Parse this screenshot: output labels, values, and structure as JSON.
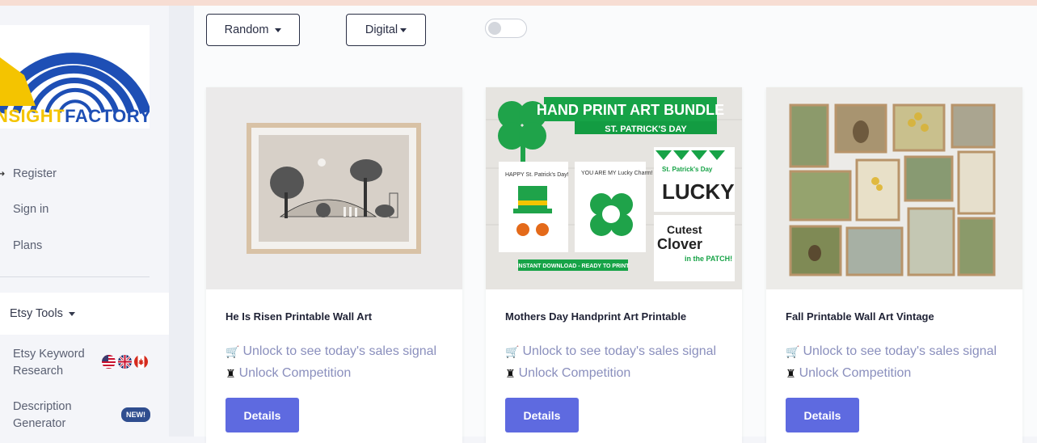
{
  "logo": {
    "part1": "NSIGHT",
    "part2": "FACTORY"
  },
  "nav": {
    "register": "Register",
    "signin": "Sign in",
    "plans": "Plans"
  },
  "tools": {
    "label": "Etsy Tools",
    "keyword_research": "Etsy Keyword Research",
    "description_generator": "Description Generator",
    "new_badge": "NEW!"
  },
  "filters": {
    "sort": "Random",
    "type": "Digital"
  },
  "cards": [
    {
      "title": "He Is Risen Printable Wall Art",
      "sales_signal": "Unlock to see today's sales signal",
      "competition": "Unlock Competition",
      "button": "Details"
    },
    {
      "title": "Mothers Day Handprint Art Printable",
      "sales_signal": "Unlock to see today's sales signal",
      "competition": "Unlock Competition",
      "button": "Details"
    },
    {
      "title": "Fall Printable Wall Art Vintage",
      "sales_signal": "Unlock to see today's sales signal",
      "competition": "Unlock Competition",
      "button": "Details"
    }
  ],
  "card2_image": {
    "banner": "HAND PRINT ART BUNDLE",
    "subbanner": "ST. PATRICK'S DAY",
    "card_a": "HAPPY St. Patrick's Day!",
    "card_b": "YOU ARE MY Lucky Charm!",
    "card_c1": "St. Patrick's Day",
    "card_c2": "LUCKY",
    "card_d1": "Cutest",
    "card_d2": "Clover",
    "card_d3": "in the PATCH!",
    "footer": "INSTANT DOWNLOAD - READY TO PRINT"
  },
  "icons": {
    "cart": "cart-icon",
    "chess": "chess-icon"
  },
  "colors": {
    "accent": "#5e6ae0",
    "link": "#8a8fbd",
    "badge": "#2f4d8f"
  }
}
